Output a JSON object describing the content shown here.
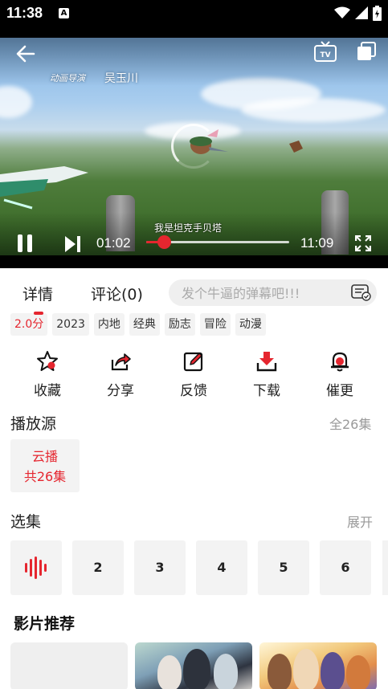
{
  "status_bar": {
    "time": "11:38",
    "notification_icon": "A"
  },
  "player": {
    "credit_role": "动画导演",
    "credit_name": "吴玉川",
    "subtitle": "我是坦克手贝塔",
    "current_time": "01:02",
    "total_time": "11:09",
    "progress_fraction": 0.125,
    "accent_color": "#e5262f"
  },
  "tabs": [
    {
      "label": "详情"
    },
    {
      "label": "评论(0)"
    }
  ],
  "danmaku": {
    "placeholder": "发个牛逼的弹幕吧!!!"
  },
  "tags": [
    "2.0分",
    "2023",
    "内地",
    "经典",
    "励志",
    "冒险",
    "动漫"
  ],
  "actions": [
    {
      "label": "收藏",
      "icon": "star-icon"
    },
    {
      "label": "分享",
      "icon": "share-icon"
    },
    {
      "label": "反馈",
      "icon": "edit-icon"
    },
    {
      "label": "下载",
      "icon": "download-icon"
    },
    {
      "label": "催更",
      "icon": "bell-icon"
    }
  ],
  "source": {
    "title": "播放源",
    "total": "全26集",
    "card_line1": "云播",
    "card_line2": "共26集"
  },
  "episodes": {
    "title": "选集",
    "expand": "展开",
    "items": [
      "1",
      "2",
      "3",
      "4",
      "5",
      "6"
    ],
    "playing": "1"
  },
  "recommend": {
    "title": "影片推荐"
  }
}
